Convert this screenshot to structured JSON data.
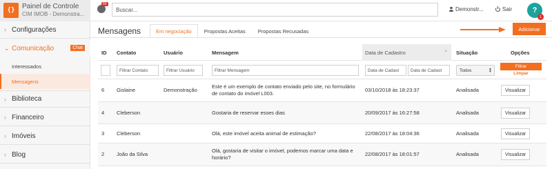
{
  "brand": {
    "logo_glyph": "{}",
    "title": "Painel de Controle",
    "subtitle": "CIM IMOB - Demonstra..."
  },
  "header": {
    "notification_count": "60",
    "search_placeholder": "Buscar...",
    "user_name": "Demonstr...",
    "logout_label": "Sair",
    "help_glyph": "?",
    "help_badge": "1"
  },
  "colors": {
    "accent": "#f26e21",
    "help": "#1ba39c",
    "badge": "#d9302b"
  },
  "sidebar": {
    "items": [
      {
        "label": "Configurações"
      },
      {
        "label": "Comunicação",
        "badge": "Chat"
      },
      {
        "label": "Biblioteca"
      },
      {
        "label": "Financeiro"
      },
      {
        "label": "Imóveis"
      },
      {
        "label": "Blog"
      }
    ],
    "sub_items": [
      {
        "label": "Interessados"
      },
      {
        "label": "Mensagens"
      }
    ]
  },
  "main": {
    "title": "Mensagens",
    "tabs": [
      {
        "label": "Em negociação"
      },
      {
        "label": "Propostas Aceitas"
      },
      {
        "label": "Propostas Recusadas"
      }
    ],
    "add_label": "Adicionar"
  },
  "table": {
    "headers": {
      "id": "ID",
      "contato": "Contato",
      "usuario": "Usuário",
      "mensagem": "Mensagem",
      "data": "Data de Cadastro",
      "situacao": "Situação",
      "opcoes": "Opções"
    },
    "filters": {
      "contato": "Filtrar Contato",
      "usuario": "Filtrar Usuário",
      "mensagem": "Filtrar Mensagem",
      "data_de": "Data de Cadast",
      "data_ate": "Data de Cadast",
      "situacao": "Todos",
      "filter_label": "Filtrar",
      "clear_label": "Limpar"
    },
    "rows": [
      {
        "id": "6",
        "contato": "Gislaine",
        "usuario": "Demonstração",
        "mensagem": "Este é um exemplo de contato enviado pelo site, no formulário de contato do imóvel L003.",
        "data": "03/10/2018 às 18:23:37",
        "situacao": "Analisada",
        "acao": "Visualizar"
      },
      {
        "id": "4",
        "contato": "Cleberson",
        "usuario": "",
        "mensagem": "Gostaria de reservar esses dias",
        "data": "20/09/2017 às 16:27:58",
        "situacao": "Analisada",
        "acao": "Visualizar"
      },
      {
        "id": "3",
        "contato": "Cleberson",
        "usuario": "",
        "mensagem": "Olá, este imóvel aceita animal de estimação?",
        "data": "22/08/2017 às 18:04:36",
        "situacao": "Analisada",
        "acao": "Visualizar"
      },
      {
        "id": "2",
        "contato": "João da Silva",
        "usuario": "",
        "mensagem": "Olá, gostaria de visitar o imóvel, podemos marcar uma data e horário?",
        "data": "22/08/2017 às 18:01:57",
        "situacao": "Analisada",
        "acao": "Visualizar"
      }
    ]
  }
}
